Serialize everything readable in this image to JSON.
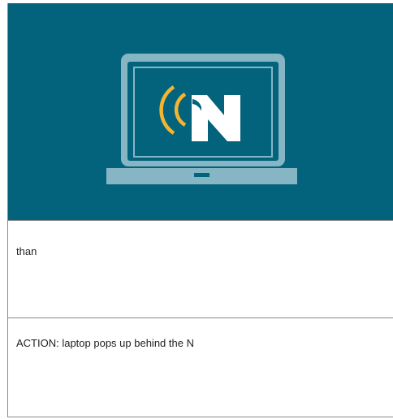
{
  "storyboard": {
    "frame_1": {
      "illustration": {
        "logo_letter": "N",
        "colors": {
          "background": "#03627c",
          "laptop": "#86b5c3",
          "screen": "#03627c",
          "waves": "#f2b531",
          "letter": "#ffffff"
        },
        "icons": [
          "laptop-icon",
          "signal-waves-icon"
        ]
      },
      "script_text": "than",
      "action_text": "ACTION: laptop pops up behind the N"
    }
  }
}
